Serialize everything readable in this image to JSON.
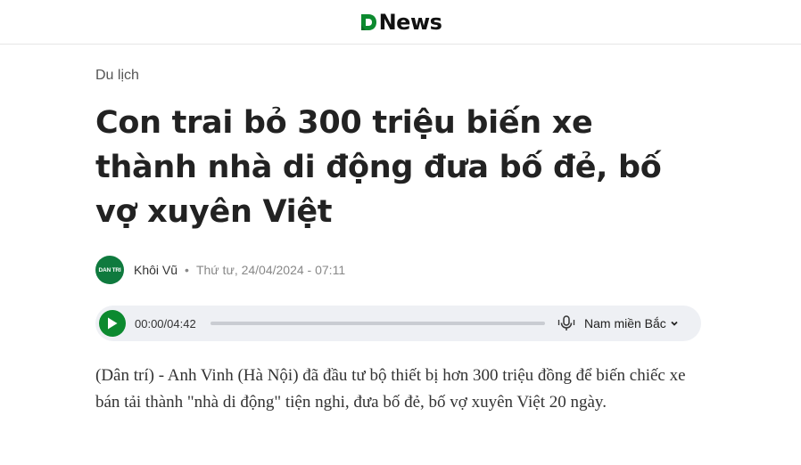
{
  "header": {
    "logo_letter": "D",
    "logo_text": "News",
    "brand_color": "#0c8a2f"
  },
  "article": {
    "category": "Du lịch",
    "title": "Con trai bỏ 300 triệu biến xe thành nhà di động đưa bố đẻ, bố vợ xuyên Việt",
    "author_avatar_text": "DAN TRI",
    "author": "Khôi Vũ",
    "date": "Thứ tư, 24/04/2024 - 07:11",
    "lead": "(Dân trí) - Anh Vinh (Hà Nội) đã đầu tư bộ thiết bị hơn 300 triệu đồng để biến chiếc xe bán tải thành \"nhà di động\" tiện nghi, đưa bố đẻ, bố vợ xuyên Việt 20 ngày."
  },
  "player": {
    "time": "00:00/04:42",
    "progress_percent": 0,
    "voice": "Nam miền Bắc",
    "icons": {
      "play": "play-icon",
      "mic": "mic-icon",
      "chevron": "chevron-down-icon"
    }
  }
}
